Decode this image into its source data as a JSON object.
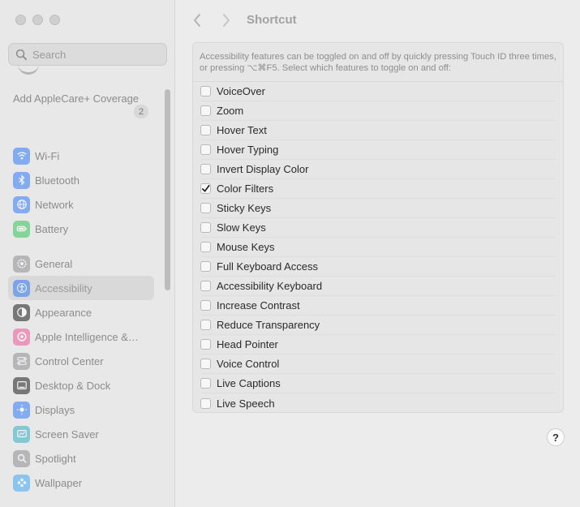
{
  "sidebar": {
    "search_placeholder": "Search",
    "applecare_label": "Add AppleCare+ Coverage",
    "applecare_badge": "2",
    "groups": [
      [
        {
          "label": "Wi-Fi",
          "icon": "wifi-icon",
          "color": "#2f7cf6"
        },
        {
          "label": "Bluetooth",
          "icon": "bluetooth-icon",
          "color": "#2f7cf6"
        },
        {
          "label": "Network",
          "icon": "network-icon",
          "color": "#2f7cf6"
        },
        {
          "label": "Battery",
          "icon": "battery-icon",
          "color": "#34c759"
        }
      ],
      [
        {
          "label": "General",
          "icon": "gear-icon",
          "color": "#8e8e93"
        },
        {
          "label": "Accessibility",
          "icon": "accessibility-icon",
          "color": "#2f7cf6",
          "selected": true
        },
        {
          "label": "Appearance",
          "icon": "appearance-icon",
          "color": "#1c1c1e"
        },
        {
          "label": "Apple Intelligence &…",
          "icon": "apple-intelligence-icon",
          "color": "#f0589a"
        },
        {
          "label": "Control Center",
          "icon": "control-center-icon",
          "color": "#8e8e93"
        },
        {
          "label": "Desktop & Dock",
          "icon": "dock-icon",
          "color": "#1c1c1e"
        },
        {
          "label": "Displays",
          "icon": "displays-icon",
          "color": "#2f7cf6"
        },
        {
          "label": "Screen Saver",
          "icon": "screen-saver-icon",
          "color": "#30b0c7"
        },
        {
          "label": "Spotlight",
          "icon": "spotlight-icon",
          "color": "#8e8e93"
        },
        {
          "label": "Wallpaper",
          "icon": "wallpaper-icon",
          "color": "#3fa9f5"
        }
      ]
    ]
  },
  "header": {
    "title": "Shortcut"
  },
  "panel": {
    "description": "Accessibility features can be toggled on and off by quickly pressing Touch ID three times, or pressing ⌥⌘F5. Select which features to toggle on and off:",
    "options": [
      {
        "label": "VoiceOver",
        "checked": false
      },
      {
        "label": "Zoom",
        "checked": false
      },
      {
        "label": "Hover Text",
        "checked": false
      },
      {
        "label": "Hover Typing",
        "checked": false
      },
      {
        "label": "Invert Display Color",
        "checked": false
      },
      {
        "label": "Color Filters",
        "checked": true
      },
      {
        "label": "Sticky Keys",
        "checked": false
      },
      {
        "label": "Slow Keys",
        "checked": false
      },
      {
        "label": "Mouse Keys",
        "checked": false
      },
      {
        "label": "Full Keyboard Access",
        "checked": false
      },
      {
        "label": "Accessibility Keyboard",
        "checked": false
      },
      {
        "label": "Increase Contrast",
        "checked": false
      },
      {
        "label": "Reduce Transparency",
        "checked": false
      },
      {
        "label": "Head Pointer",
        "checked": false
      },
      {
        "label": "Voice Control",
        "checked": false
      },
      {
        "label": "Live Captions",
        "checked": false
      },
      {
        "label": "Live Speech",
        "checked": false
      }
    ]
  },
  "help_label": "?"
}
